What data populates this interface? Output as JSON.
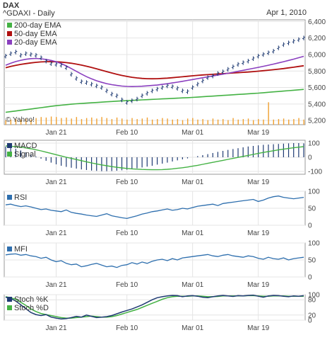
{
  "header": {
    "title": "DAX",
    "ticker": "^GDAXI - Daily",
    "date": "Apr 1, 2010",
    "watermark": "© Yahoo!"
  },
  "colors": {
    "price": "#1f3b73",
    "ema200": "#44b244",
    "ema50": "#b01010",
    "ema20": "#8a3fbf",
    "volume": "#f0a030",
    "macd": "#1f3b73",
    "signal": "#44b244",
    "rsi": "#2e6fae",
    "mfi": "#2e6fae",
    "stochK": "#1f3b73",
    "stochD": "#44b244",
    "grid": "#e4e4e4",
    "frame": "#9a9a9a",
    "title": "#000000",
    "ticker": "#2a5db0",
    "date": "#b0b0b0"
  },
  "chart_data": [
    {
      "type": "line",
      "panel": "price",
      "x_tick_labels": [
        "Jan 21",
        "Feb 10",
        "Mar 01",
        "Mar 19"
      ],
      "x_tick_index": [
        10,
        24,
        37,
        50
      ],
      "y_ticks": [
        5200,
        5400,
        5600,
        5800,
        6000,
        6200,
        6400
      ],
      "y_tick_labels": [
        "5,200",
        "5,400",
        "5,600",
        "5,800",
        "6,000",
        "6,200",
        "6,400"
      ],
      "ylim": [
        5150,
        6420
      ],
      "grid": true,
      "legend_position": "top-left",
      "series": [
        {
          "name": "200-day EMA",
          "style": "line",
          "values": [
            5300,
            5308,
            5316,
            5324,
            5332,
            5340,
            5348,
            5356,
            5364,
            5372,
            5380,
            5386,
            5392,
            5398,
            5403,
            5407,
            5411,
            5415,
            5419,
            5423,
            5427,
            5431,
            5435,
            5438,
            5441,
            5444,
            5447,
            5450,
            5453,
            5456,
            5459,
            5462,
            5465,
            5468,
            5471,
            5474,
            5477,
            5480,
            5484,
            5488,
            5492,
            5496,
            5500,
            5504,
            5508,
            5512,
            5516,
            5520,
            5524,
            5528,
            5532,
            5537,
            5542,
            5547,
            5552,
            5557,
            5562,
            5567,
            5572,
            5577
          ]
        },
        {
          "name": "50-day EMA",
          "style": "line",
          "values": [
            5840,
            5855,
            5868,
            5880,
            5890,
            5898,
            5905,
            5910,
            5913,
            5914,
            5912,
            5908,
            5902,
            5894,
            5884,
            5872,
            5858,
            5843,
            5827,
            5810,
            5793,
            5776,
            5760,
            5746,
            5734,
            5724,
            5716,
            5710,
            5707,
            5706,
            5707,
            5710,
            5714,
            5719,
            5725,
            5730,
            5736,
            5742,
            5747,
            5752,
            5756,
            5760,
            5764,
            5768,
            5772,
            5776,
            5780,
            5784,
            5788,
            5793,
            5798,
            5804,
            5810,
            5816,
            5823,
            5830,
            5838,
            5846,
            5855,
            5864
          ]
        },
        {
          "name": "20-day EMA",
          "style": "line",
          "values": [
            5870,
            5895,
            5915,
            5930,
            5942,
            5950,
            5952,
            5948,
            5940,
            5928,
            5912,
            5890,
            5862,
            5830,
            5796,
            5763,
            5732,
            5705,
            5682,
            5663,
            5647,
            5635,
            5625,
            5618,
            5613,
            5612,
            5613,
            5616,
            5620,
            5625,
            5630,
            5638,
            5646,
            5655,
            5665,
            5675,
            5686,
            5697,
            5708,
            5718,
            5729,
            5740,
            5751,
            5762,
            5773,
            5784,
            5796,
            5808,
            5820,
            5832,
            5844,
            5857,
            5870,
            5884,
            5898,
            5913,
            5928,
            5944,
            5961,
            5978
          ]
        },
        {
          "name": "",
          "style": "ohlc",
          "values": [
            5980,
            6010,
            6030,
            5990,
            6010,
            6000,
            5990,
            5960,
            5920,
            5890,
            5880,
            5870,
            5840,
            5760,
            5710,
            5670,
            5660,
            5640,
            5620,
            5600,
            5560,
            5520,
            5500,
            5450,
            5420,
            5440,
            5460,
            5500,
            5530,
            5560,
            5580,
            5600,
            5620,
            5610,
            5590,
            5560,
            5550,
            5600,
            5640,
            5680,
            5720,
            5740,
            5770,
            5790,
            5820,
            5850,
            5880,
            5900,
            5920,
            5950,
            5980,
            6000,
            6020,
            6040,
            6080,
            6120,
            6140,
            6160,
            6180,
            6200
          ]
        }
      ]
    },
    {
      "type": "bar",
      "panel": "volume",
      "values": [
        0.18,
        0.2,
        0.22,
        0.2,
        0.24,
        0.2,
        0.26,
        0.3,
        0.28,
        0.32,
        0.3,
        0.26,
        0.28,
        0.24,
        0.3,
        0.22,
        0.26,
        0.28,
        0.24,
        0.3,
        0.26,
        0.22,
        0.28,
        0.24,
        0.2,
        0.26,
        0.22,
        0.24,
        0.28,
        0.2,
        0.22,
        0.26,
        0.24,
        0.2,
        0.22,
        0.18,
        0.24,
        0.26,
        0.2,
        0.22,
        0.18,
        0.24,
        0.2,
        0.22,
        0.18,
        0.26,
        0.2,
        0.22,
        0.24,
        0.18,
        0.22,
        0.2,
        0.88,
        0.2,
        0.22,
        0.24,
        0.2,
        0.22,
        0.26,
        0.2
      ]
    },
    {
      "type": "line",
      "panel": "macd",
      "x_tick_labels": [
        "Jan 21",
        "Feb 10",
        "Mar 01",
        "Mar 19"
      ],
      "y_ticks": [
        100,
        0,
        -100
      ],
      "y_tick_labels": [
        "100",
        "0",
        "-100"
      ],
      "ylim": [
        -120,
        120
      ],
      "grid": true,
      "legend_position": "top-left",
      "series": [
        {
          "name": "MACD",
          "style": "bars",
          "values": [
            75,
            70,
            60,
            48,
            35,
            20,
            5,
            -10,
            -25,
            -38,
            -50,
            -60,
            -68,
            -74,
            -80,
            -86,
            -90,
            -94,
            -96,
            -98,
            -98,
            -97,
            -95,
            -92,
            -88,
            -84,
            -78,
            -72,
            -66,
            -60,
            -52,
            -45,
            -38,
            -30,
            -22,
            -15,
            -8,
            0,
            8,
            15,
            22,
            30,
            38,
            45,
            52,
            58,
            64,
            70,
            76,
            80,
            84,
            88,
            90,
            92,
            94,
            96,
            98,
            100,
            100,
            98
          ]
        },
        {
          "name": "Signal",
          "style": "line",
          "values": [
            80,
            78,
            75,
            71,
            66,
            60,
            53,
            45,
            36,
            27,
            18,
            9,
            0,
            -8,
            -16,
            -24,
            -32,
            -40,
            -47,
            -54,
            -60,
            -66,
            -71,
            -75,
            -79,
            -82,
            -84,
            -86,
            -87,
            -88,
            -88,
            -87,
            -85,
            -82,
            -78,
            -74,
            -69,
            -63,
            -57,
            -50,
            -43,
            -36,
            -29,
            -22,
            -15,
            -8,
            -1,
            6,
            13,
            20,
            27,
            34,
            40,
            46,
            52,
            57,
            62,
            67,
            71,
            75
          ]
        }
      ]
    },
    {
      "type": "line",
      "panel": "rsi",
      "x_tick_labels": [
        "Jan 21",
        "Feb 10",
        "Mar 01",
        "Mar 19"
      ],
      "y_ticks": [
        100,
        50,
        0
      ],
      "y_tick_labels": [
        "100",
        "50",
        "0"
      ],
      "ylim": [
        0,
        100
      ],
      "grid": true,
      "series": [
        {
          "name": "RSI",
          "values": [
            60,
            62,
            58,
            55,
            57,
            54,
            50,
            46,
            48,
            44,
            42,
            40,
            45,
            38,
            35,
            33,
            30,
            28,
            26,
            30,
            34,
            28,
            25,
            22,
            20,
            24,
            28,
            33,
            36,
            40,
            42,
            45,
            48,
            44,
            46,
            50,
            48,
            52,
            56,
            58,
            60,
            62,
            58,
            64,
            66,
            68,
            70,
            72,
            74,
            76,
            70,
            74,
            80,
            84,
            86,
            82,
            80,
            78,
            80,
            82
          ]
        }
      ]
    },
    {
      "type": "line",
      "panel": "mfi",
      "x_tick_labels": [
        "Jan 21",
        "Feb 10",
        "Mar 01",
        "Mar 19"
      ],
      "y_ticks": [
        100,
        50,
        0
      ],
      "y_tick_labels": [
        "100",
        "50",
        "0"
      ],
      "ylim": [
        0,
        100
      ],
      "grid": true,
      "series": [
        {
          "name": "MFI",
          "values": [
            65,
            67,
            68,
            64,
            66,
            62,
            60,
            55,
            58,
            50,
            45,
            48,
            40,
            36,
            38,
            30,
            33,
            37,
            40,
            35,
            30,
            32,
            28,
            34,
            36,
            42,
            38,
            44,
            40,
            46,
            50,
            52,
            48,
            54,
            50,
            56,
            58,
            60,
            62,
            64,
            66,
            62,
            60,
            64,
            66,
            62,
            60,
            58,
            62,
            60,
            55,
            52,
            58,
            54,
            52,
            56,
            50,
            54,
            56,
            58
          ]
        }
      ]
    },
    {
      "type": "line",
      "panel": "stochastic",
      "x_tick_labels": [
        "Jan 21",
        "Feb 10",
        "Mar 01",
        "Mar 19"
      ],
      "y_ticks": [
        100,
        80,
        20,
        0
      ],
      "y_tick_labels": [
        "100",
        "80",
        "20",
        "0"
      ],
      "ylim": [
        0,
        100
      ],
      "grid": true,
      "legend_position": "top-left",
      "series": [
        {
          "name": "Stoch %K",
          "values": [
            90,
            85,
            75,
            60,
            45,
            30,
            22,
            18,
            22,
            12,
            8,
            5,
            6,
            10,
            15,
            12,
            20,
            15,
            10,
            12,
            14,
            18,
            25,
            32,
            38,
            44,
            52,
            60,
            70,
            80,
            88,
            92,
            95,
            97,
            96,
            92,
            95,
            96,
            94,
            90,
            88,
            92,
            95,
            97,
            95,
            93,
            96,
            95,
            97,
            98,
            94,
            90,
            95,
            97,
            96,
            94,
            92,
            95,
            94,
            96
          ]
        },
        {
          "name": "Stoch %D",
          "values": [
            92,
            88,
            82,
            70,
            58,
            44,
            34,
            26,
            22,
            18,
            14,
            10,
            8,
            8,
            10,
            12,
            14,
            16,
            14,
            12,
            12,
            14,
            18,
            24,
            30,
            36,
            42,
            50,
            58,
            66,
            74,
            82,
            88,
            92,
            94,
            94,
            94,
            95,
            95,
            94,
            92,
            92,
            93,
            95,
            95,
            95,
            95,
            95,
            96,
            96,
            95,
            94,
            94,
            95,
            95,
            95,
            94,
            94,
            94,
            94
          ]
        }
      ]
    }
  ]
}
